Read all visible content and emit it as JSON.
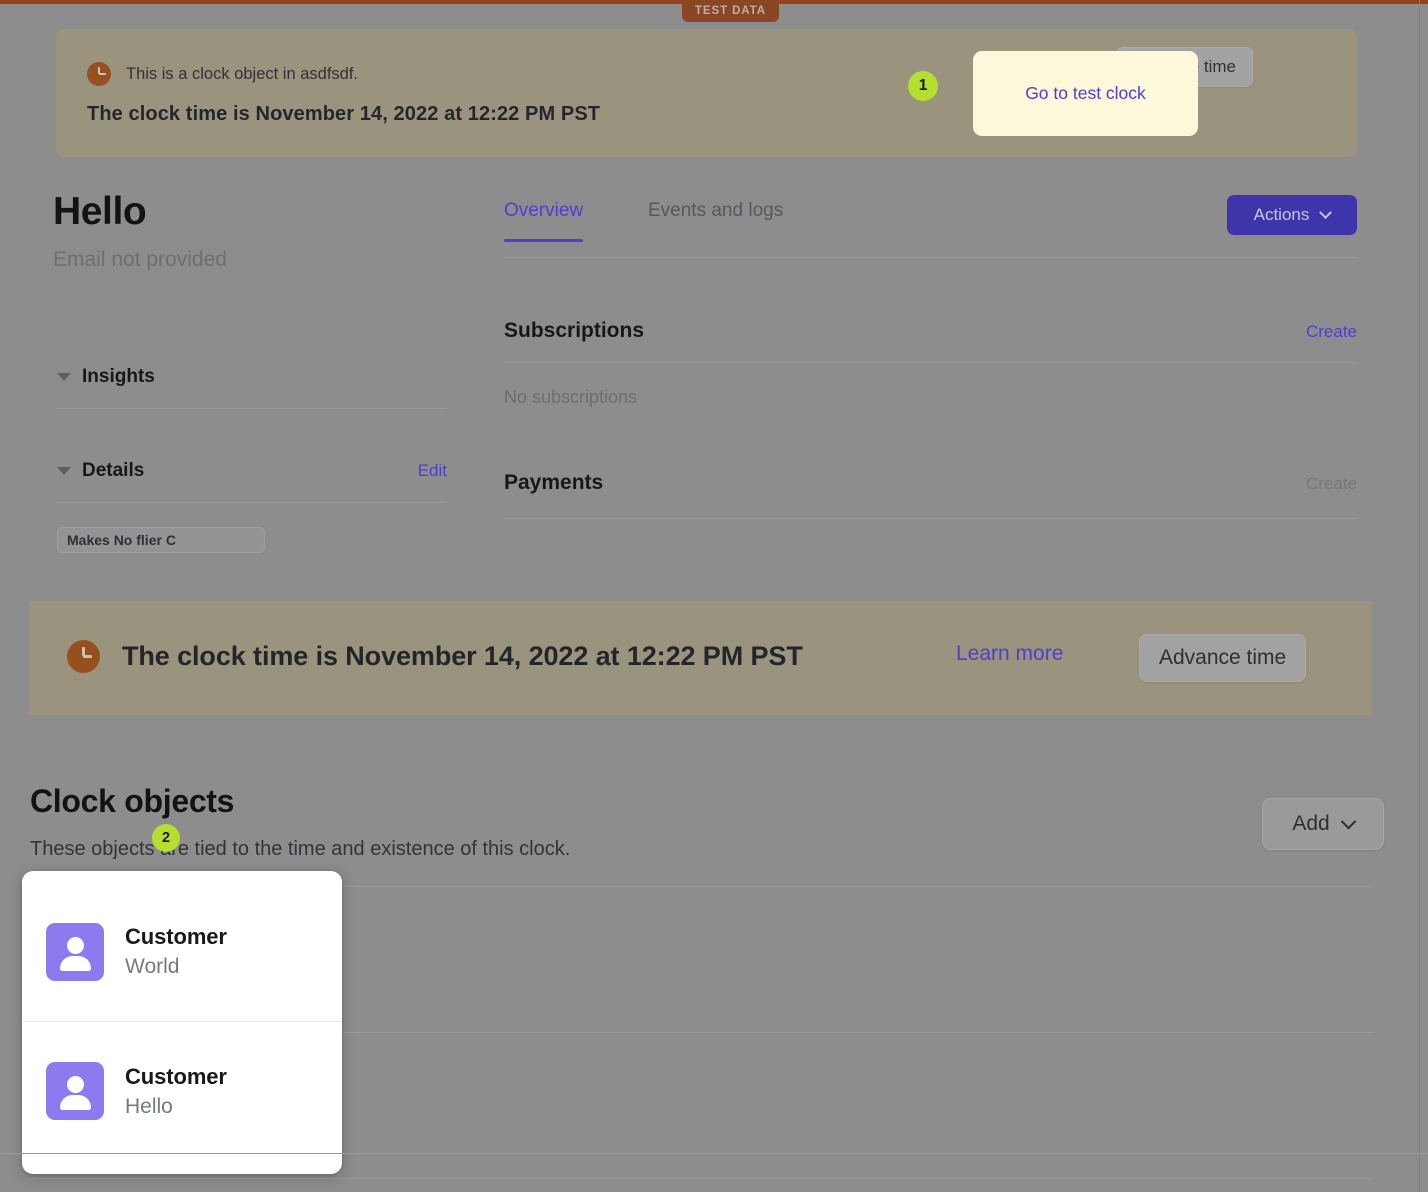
{
  "badges": {
    "test_data": "TEST DATA",
    "marker_1": "1",
    "marker_2": "2"
  },
  "colors": {
    "accent_purple": "#4b3fd2",
    "actions_button": "#3f35ab",
    "banner_bg": "#9a947f",
    "clock_icon": "#96501f",
    "marker_green": "#b6de31",
    "highlight_yellow": "#fdf8d9",
    "avatar_purple": "#8c7bee",
    "test_mode_border": "#94421b"
  },
  "top_banner": {
    "icon": "clock-icon",
    "line1": "This is a clock object in asdfsdf.",
    "line2": "The clock time is November 14, 2022 at 12:22 PM PST",
    "go_to_test_clock_label": "Go to test clock",
    "advance_time_label": "Advance time"
  },
  "left": {
    "customer_name": "Hello",
    "customer_email": "Email not provided",
    "sections": [
      {
        "title": "Insights",
        "action": ""
      },
      {
        "title": "Details",
        "action": "Edit"
      }
    ],
    "clipped_pill": "Makes No flier C"
  },
  "main": {
    "tabs": [
      {
        "label": "Overview",
        "active": true
      },
      {
        "label": "Events and logs",
        "active": false
      }
    ],
    "actions_label": "Actions",
    "sections": [
      {
        "title": "Subscriptions",
        "action": "Create",
        "empty_text": "No subscriptions"
      },
      {
        "title": "Payments",
        "action": "Create",
        "empty_text": ""
      }
    ]
  },
  "mid_banner": {
    "icon": "clock-icon",
    "text": "The clock time is November 14, 2022 at 12:22 PM PST",
    "learn_more_label": "Learn more",
    "advance_time_label": "Advance time"
  },
  "clock_objects": {
    "title": "Clock objects",
    "subtitle": "These objects are tied to the time and existence of this clock.",
    "add_label": "Add",
    "dropdown_items": [
      {
        "type": "Customer",
        "name": "World",
        "icon": "person-avatar-icon"
      },
      {
        "type": "Customer",
        "name": "Hello",
        "icon": "person-avatar-icon"
      }
    ]
  }
}
